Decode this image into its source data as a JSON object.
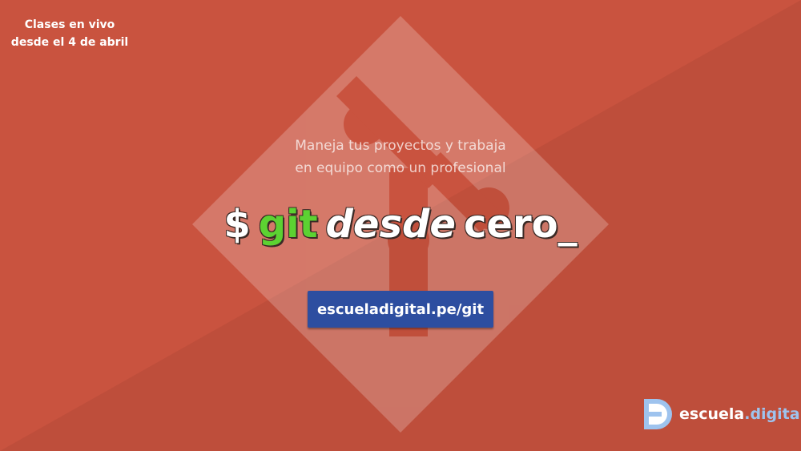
{
  "colors": {
    "background": "#c9533f",
    "background_shade": "#b54b39",
    "accent_green": "#5cd232",
    "button_blue": "#2d4ea0",
    "logo_blue": "#9ec3ee"
  },
  "top_note": {
    "line1": "Clases en vivo",
    "line2": "desde el 4 de abril"
  },
  "subtitle": {
    "line1": "Maneja tus proyectos y trabaja",
    "line2": "en equipo como un profesional"
  },
  "headline": {
    "dollar": "$",
    "git": "git",
    "desde": "desde",
    "cero": "cero_"
  },
  "cta": {
    "label": "escueladigital.pe/git"
  },
  "brand": {
    "name": "escuela",
    "dot": ".",
    "suffix": "digital",
    "icon": "escuela-digital-logo-icon"
  },
  "watermark_icon": "git-logo-icon"
}
